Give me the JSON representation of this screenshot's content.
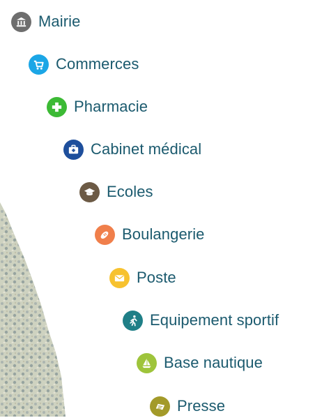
{
  "menu": {
    "items": [
      {
        "label": "Mairie",
        "icon": "town-hall-icon",
        "color": "#6e6e6e"
      },
      {
        "label": "Commerces",
        "icon": "shopping-cart-icon",
        "color": "#1ba6e6"
      },
      {
        "label": "Pharmacie",
        "icon": "pharmacy-cross-icon",
        "color": "#3cba35"
      },
      {
        "label": "Cabinet médical",
        "icon": "medical-kit-icon",
        "color": "#1e4f9c"
      },
      {
        "label": "Ecoles",
        "icon": "graduation-cap-icon",
        "color": "#6c5a45"
      },
      {
        "label": "Boulangerie",
        "icon": "bread-icon",
        "color": "#f07f4b"
      },
      {
        "label": "Poste",
        "icon": "envelope-icon",
        "color": "#f7c22f"
      },
      {
        "label": "Equipement sportif",
        "icon": "runner-icon",
        "color": "#1f7f87"
      },
      {
        "label": "Base nautique",
        "icon": "sailboat-icon",
        "color": "#9ec43b"
      },
      {
        "label": "Presse",
        "icon": "newspaper-icon",
        "color": "#a39a29"
      }
    ]
  }
}
